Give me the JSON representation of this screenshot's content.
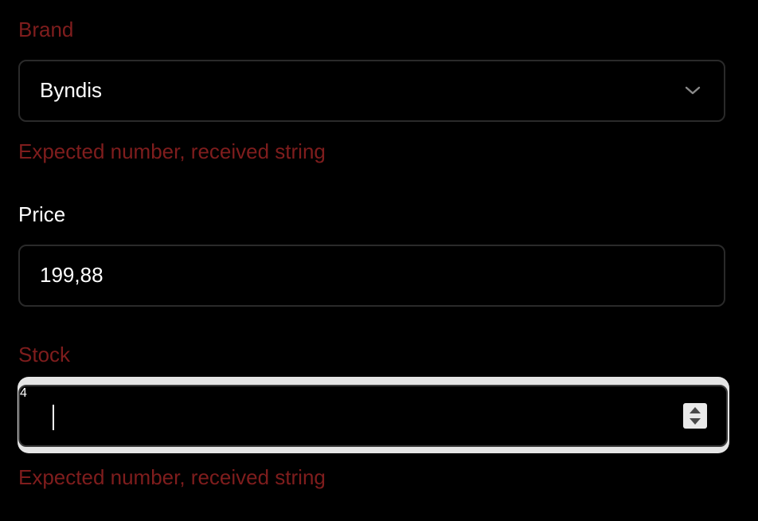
{
  "brand": {
    "label": "Brand",
    "selected_value": "Byndis",
    "error_message": "Expected number, received string"
  },
  "price": {
    "label": "Price",
    "value": "199,88"
  },
  "stock": {
    "label": "Stock",
    "value": "4",
    "error_message": "Expected number, received string"
  },
  "colors": {
    "error": "#7f1d1d",
    "background": "#000000",
    "border": "#2a2a2a",
    "text": "#ffffff",
    "focus_ring": "#e5e5e5"
  },
  "icons": {
    "select_arrow": "chevron-down-icon",
    "number_spinner": "spinner-arrows-icon"
  }
}
